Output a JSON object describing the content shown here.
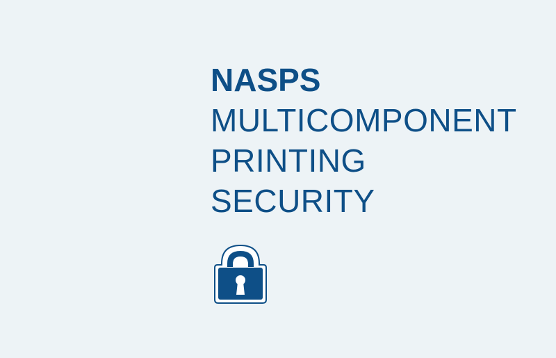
{
  "heading": {
    "brand": "NASPS",
    "lines": [
      "MULTICOMPONENT",
      "PRINTING",
      "SECURITY"
    ]
  },
  "icon": "padlock-icon",
  "colors": {
    "background": "#edf3f6",
    "accent": "#0e4f87",
    "keyhole": "#ffffff"
  }
}
